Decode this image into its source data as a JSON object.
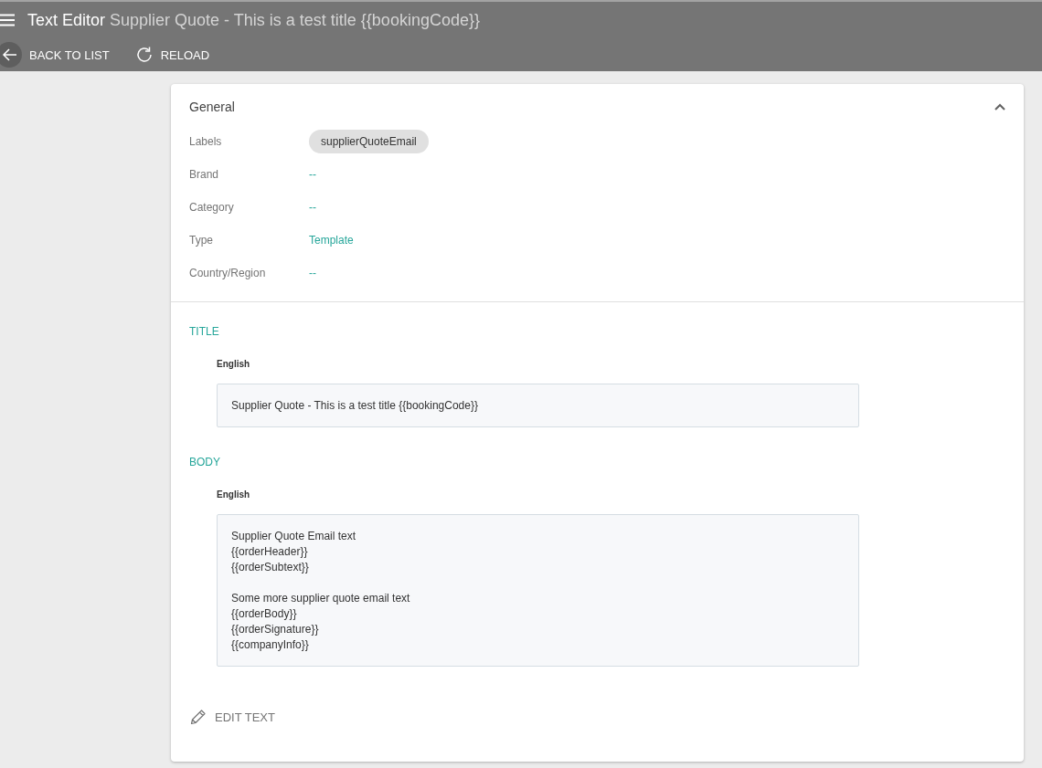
{
  "header": {
    "title": "Text Editor",
    "subtitle": "Supplier Quote - This is a test title {{bookingCode}}"
  },
  "toolbar": {
    "buttons": [
      {
        "kind": "back",
        "label": "BACK TO LIST"
      },
      {
        "kind": "reload",
        "label": "RELOAD"
      }
    ]
  },
  "general": {
    "heading": "General",
    "expanded": true,
    "fields": [
      {
        "label": "Labels",
        "kind": "chips",
        "chips": [
          "supplierQuoteEmail"
        ]
      },
      {
        "label": "Brand",
        "kind": "text",
        "value": "--"
      },
      {
        "label": "Category",
        "kind": "text",
        "value": "--"
      },
      {
        "label": "Type",
        "kind": "text",
        "value": "Template"
      },
      {
        "label": "Country/Region",
        "kind": "text",
        "value": "--"
      }
    ]
  },
  "sections": [
    {
      "heading": "TITLE",
      "language": "English",
      "paragraphs": [
        [
          "Supplier Quote - This is a test title {{bookingCode}}"
        ]
      ]
    },
    {
      "heading": "BODY",
      "language": "English",
      "paragraphs": [
        [
          "Supplier Quote Email text",
          "{{orderHeader}}",
          "{{orderSubtext}}"
        ],
        [
          "Some more supplier quote email text",
          "{{orderBody}}",
          "{{orderSignature}}",
          "{{companyInfo}}"
        ]
      ]
    }
  ],
  "edit_button": {
    "label": "EDIT TEXT"
  }
}
